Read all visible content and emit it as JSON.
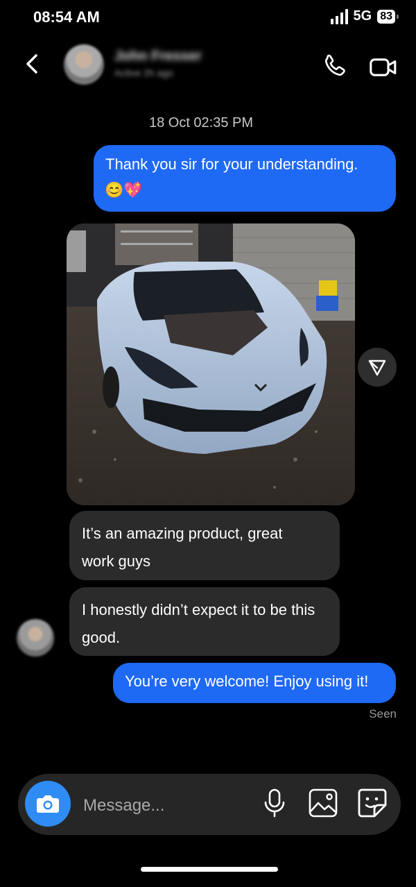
{
  "status_bar": {
    "time": "08:54 AM",
    "network": "5G",
    "battery": "83"
  },
  "header": {
    "contact_name": "John Fresser",
    "contact_status": "Active 2h ago",
    "icons": [
      "chevron-left-icon",
      "phone-icon",
      "video-camera-icon"
    ]
  },
  "thread": {
    "timestamp": "18 Oct 02:35 PM",
    "messages": [
      {
        "from": "me",
        "text": "Thank you sir for your understanding.",
        "emoji": "😊💖"
      },
      {
        "from": "them",
        "type": "photo",
        "alt": "Light blue sports car in a detailing garage"
      },
      {
        "from": "them",
        "text": "It’s an amazing product, great work guys"
      },
      {
        "from": "them",
        "text": "I honestly didn’t expect it to be this good."
      },
      {
        "from": "me",
        "text": "You’re very welcome! Enjoy using it!"
      }
    ],
    "seen_label": "Seen"
  },
  "composer": {
    "placeholder": "Message...",
    "icons": [
      "camera-icon",
      "microphone-icon",
      "image-icon",
      "sticker-icon"
    ]
  },
  "colors": {
    "outgoing": "#1f6af5",
    "incoming": "#2b2b2b",
    "camera_button": "#2f8cf4",
    "background": "#000000"
  }
}
